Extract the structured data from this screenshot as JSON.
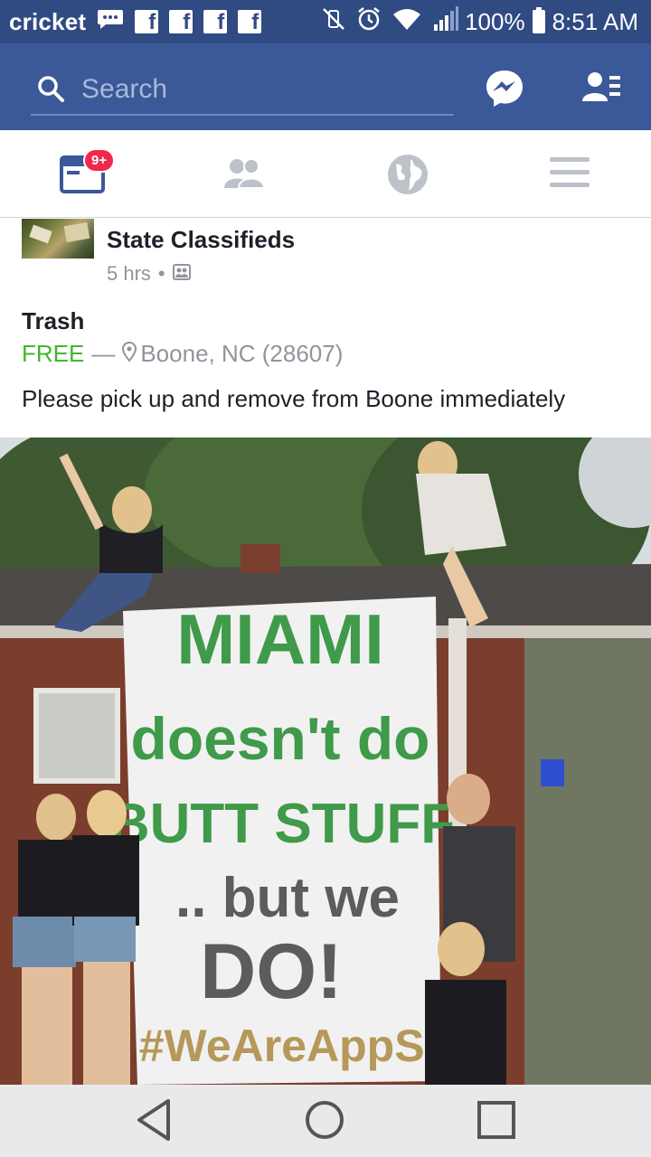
{
  "status_bar": {
    "carrier": "cricket",
    "notification_icons": [
      "message-icon",
      "facebook-icon",
      "facebook-icon",
      "facebook-icon",
      "facebook-icon"
    ],
    "fb_letter": "f",
    "right_icons": [
      "vibrate-off-icon",
      "alarm-icon",
      "wifi-icon",
      "signal-icon"
    ],
    "battery": "100%",
    "time": "8:51 AM"
  },
  "header": {
    "search_placeholder": "Search",
    "colors": {
      "bar": "#3b5998",
      "status": "#304a82"
    }
  },
  "tabs": [
    {
      "name": "news-feed",
      "icon": "news-feed-icon",
      "badge": "9+",
      "active": true
    },
    {
      "name": "friends",
      "icon": "friends-icon"
    },
    {
      "name": "notifications",
      "icon": "globe-icon"
    },
    {
      "name": "menu",
      "icon": "hamburger-menu-icon"
    }
  ],
  "post": {
    "author": "State Classifieds",
    "time": "5 hrs",
    "dot": "•",
    "privacy_icon": "group-icon",
    "listing": {
      "title": "Trash",
      "price": "FREE",
      "dash": "—",
      "location": "Boone, NC (28607)",
      "description": "Please pick up and remove from Boone immediately"
    },
    "photo_text": {
      "line1": "MIAMI",
      "line2": "doesn't do",
      "line3": "BUTT STUFF",
      "line4": ".. but we",
      "line5": "DO!",
      "line6": "#WeAreAppSt"
    }
  },
  "nav_bar": {
    "buttons": [
      "back-button",
      "home-button",
      "recents-button"
    ]
  }
}
